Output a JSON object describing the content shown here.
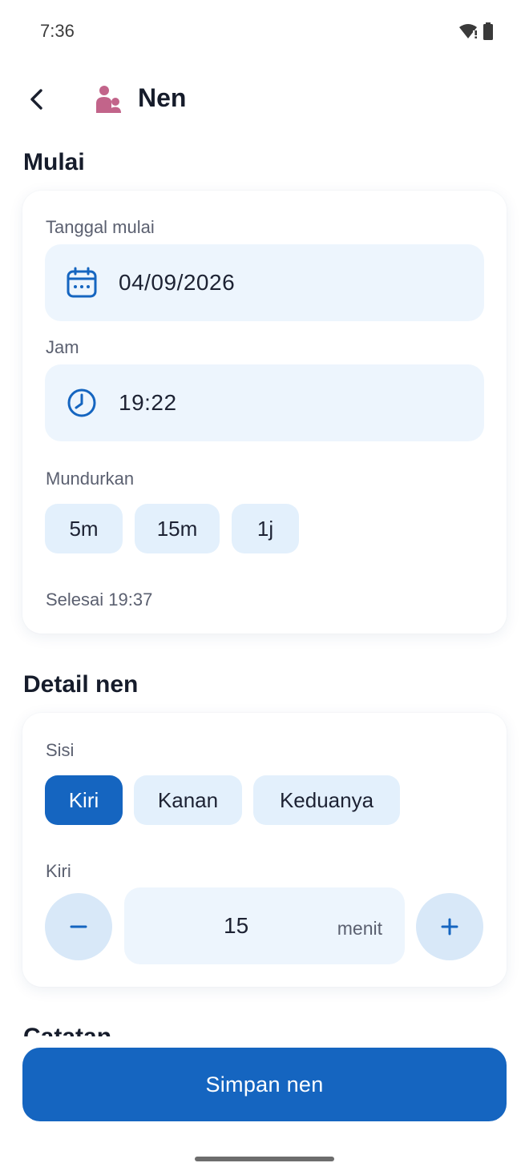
{
  "status_bar": {
    "time": "7:36"
  },
  "header": {
    "title": "Nen"
  },
  "start_section": {
    "title": "Mulai",
    "date_label": "Tanggal mulai",
    "date_value": "04/09/2026",
    "time_label": "Jam",
    "time_value": "19:22",
    "postpone_label": "Mundurkan",
    "postpone_options": [
      "5m",
      "15m",
      "1j"
    ],
    "end_text": "Selesai 19:37"
  },
  "detail_section": {
    "title": "Detail nen",
    "side_label": "Sisi",
    "side_options": [
      "Kiri",
      "Kanan",
      "Keduanya"
    ],
    "selected_side": "Kiri",
    "duration_label": "Kiri",
    "duration_value": "15",
    "duration_unit": "menit"
  },
  "notes_section": {
    "title": "Catatan"
  },
  "save_button": {
    "label": "Simpan nen"
  },
  "colors": {
    "primary": "#1565c0",
    "chip": "#e3f0fc",
    "field": "#edf5fd",
    "title_icon": "#c2648a"
  }
}
